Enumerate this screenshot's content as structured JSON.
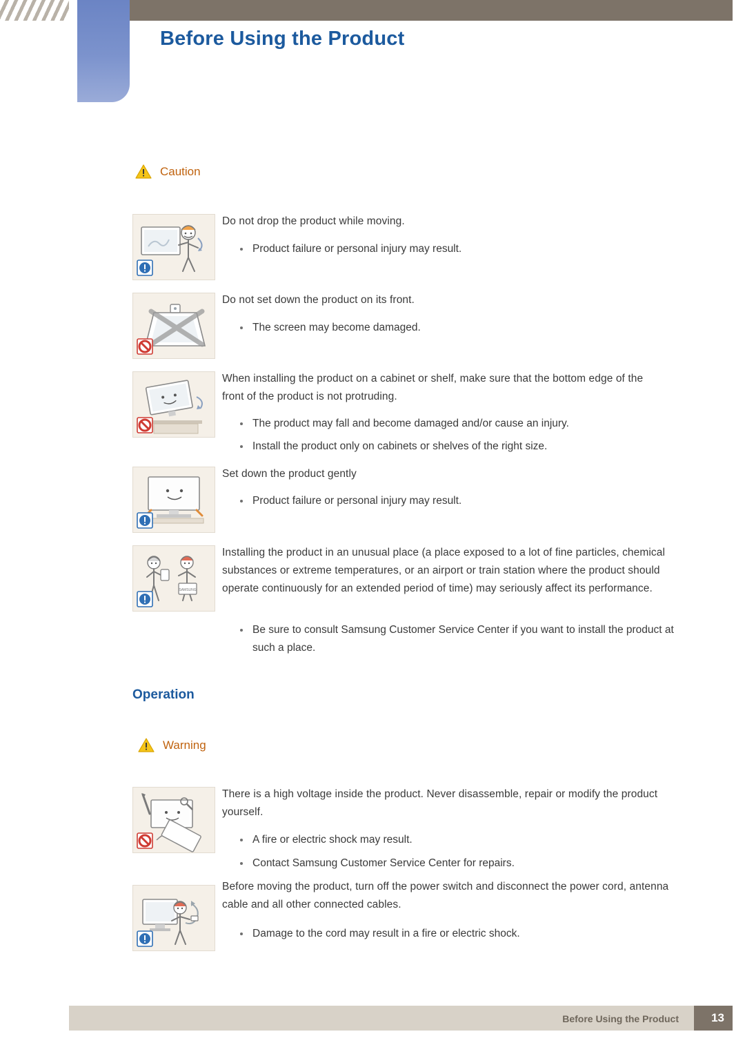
{
  "header": {
    "title": "Before Using the Product"
  },
  "sections": {
    "caution": {
      "label": "Caution",
      "icon": "warning-triangle-icon"
    },
    "operation": {
      "heading": "Operation"
    },
    "warning": {
      "label": "Warning",
      "icon": "warning-triangle-icon"
    }
  },
  "caution_items": [
    {
      "icon": "person-carrying-monitor-icon",
      "badge": "info-blue-icon",
      "text": "Do not drop the product while moving.",
      "bullets": [
        "Product failure or personal injury may result."
      ]
    },
    {
      "icon": "monitor-face-down-crossed-icon",
      "badge": "prohibited-red-icon",
      "text": "Do not set down the product on its front.",
      "bullets": [
        "The screen may become damaged."
      ]
    },
    {
      "icon": "monitor-protruding-edge-icon",
      "badge": "prohibited-red-icon",
      "text": "When installing the product on a cabinet or shelf, make sure that the bottom edge of the front of the product is not protruding.",
      "bullets": [
        "The product may fall and become damaged and/or cause an injury.",
        "Install the product only on cabinets or shelves of the right size."
      ]
    },
    {
      "icon": "set-down-gently-icon",
      "badge": "info-blue-icon",
      "text": "Set down the product gently",
      "bullets": [
        "Product failure or personal injury may result."
      ]
    },
    {
      "icon": "unusual-place-installation-icon",
      "badge": "info-blue-icon",
      "text": "Installing the product in an unusual place (a place exposed to a lot of fine particles, chemical substances or extreme temperatures, or an airport or train station where the product should operate continuously for an extended period of time) may seriously affect its performance.",
      "bullets": [
        "Be sure to consult Samsung Customer Service Center if you want to install the product at such a place."
      ]
    }
  ],
  "warning_items": [
    {
      "icon": "disassemble-product-crossed-icon",
      "badge": "prohibited-red-icon",
      "text": "There is a high voltage inside the product. Never disassemble, repair or modify the product yourself.",
      "bullets": [
        "A fire or electric shock may result.",
        "Contact Samsung Customer Service Center for repairs."
      ]
    },
    {
      "icon": "unplug-power-before-moving-icon",
      "badge": "info-blue-icon",
      "text": "Before moving the product, turn off the power switch and disconnect the power cord, antenna cable and all other connected cables.",
      "bullets": [
        "Damage to the cord may result in a fire or electric shock."
      ]
    }
  ],
  "footer": {
    "text": "Before Using the Product",
    "page": "13"
  },
  "colors": {
    "header_band": "#7d7368",
    "tab_blue": "#7c93cd",
    "title_blue": "#1c5a9e",
    "caution_orange": "#c0630f",
    "thumb_bg": "#f5f0e8",
    "footer_band": "#d8d2c8"
  }
}
